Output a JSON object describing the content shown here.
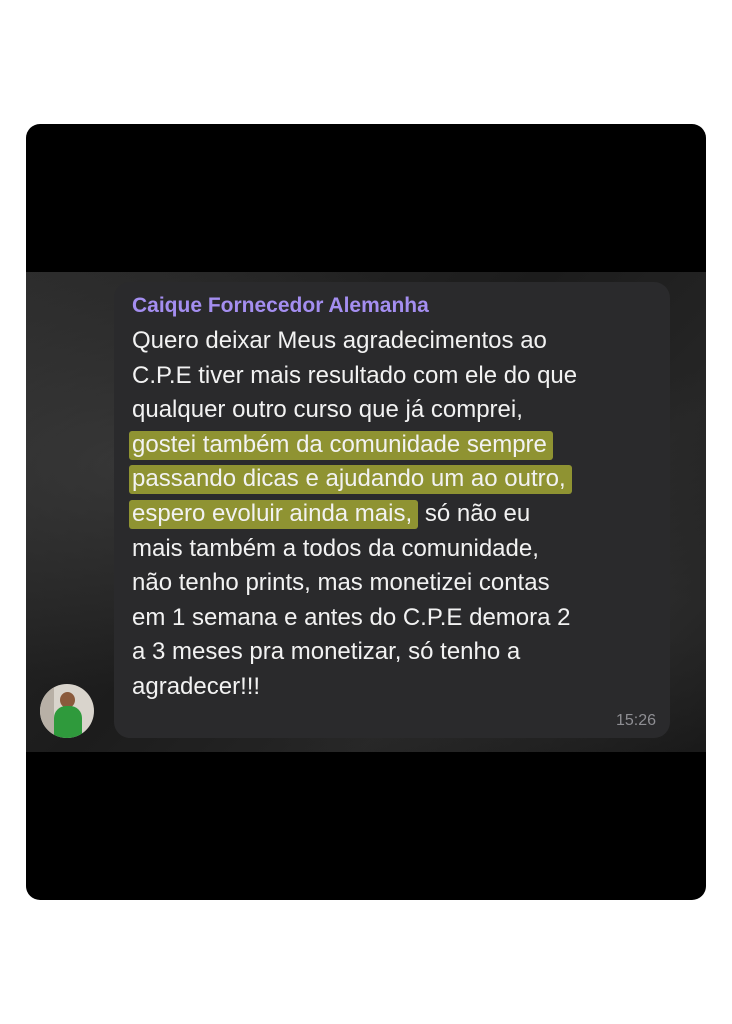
{
  "message": {
    "sender": "Caique Fornecedor Alemanha",
    "time": "15:26",
    "lines": [
      {
        "text": "Quero deixar Meus agradecimentos ao"
      },
      {
        "text": "C.P.E tiver mais resultado com ele do que"
      },
      {
        "text": "qualquer outro curso que já comprei,"
      },
      {
        "highlight": "gostei também da comunidade sempre",
        "text": ""
      },
      {
        "highlight": "passando dicas e ajudando um ao outro,",
        "text": ""
      },
      {
        "highlight": "espero evoluir ainda mais,",
        "text": " só não eu"
      },
      {
        "text": "mais também a todos da comunidade,"
      },
      {
        "text": "não tenho prints, mas monetizei contas"
      },
      {
        "text": "em 1 semana e antes do C.P.E demora 2"
      },
      {
        "text": "a 3 meses pra monetizar, só tenho a"
      },
      {
        "text": "agradecer!!!"
      }
    ]
  },
  "colors": {
    "sender_name": "#a48ef0",
    "highlight": "#cdd437",
    "bubble": "#2a2a2c",
    "message_text": "#f2f2f2",
    "time_text": "#8e8e93"
  },
  "icons": {
    "avatar": "user-photo-avatar"
  }
}
